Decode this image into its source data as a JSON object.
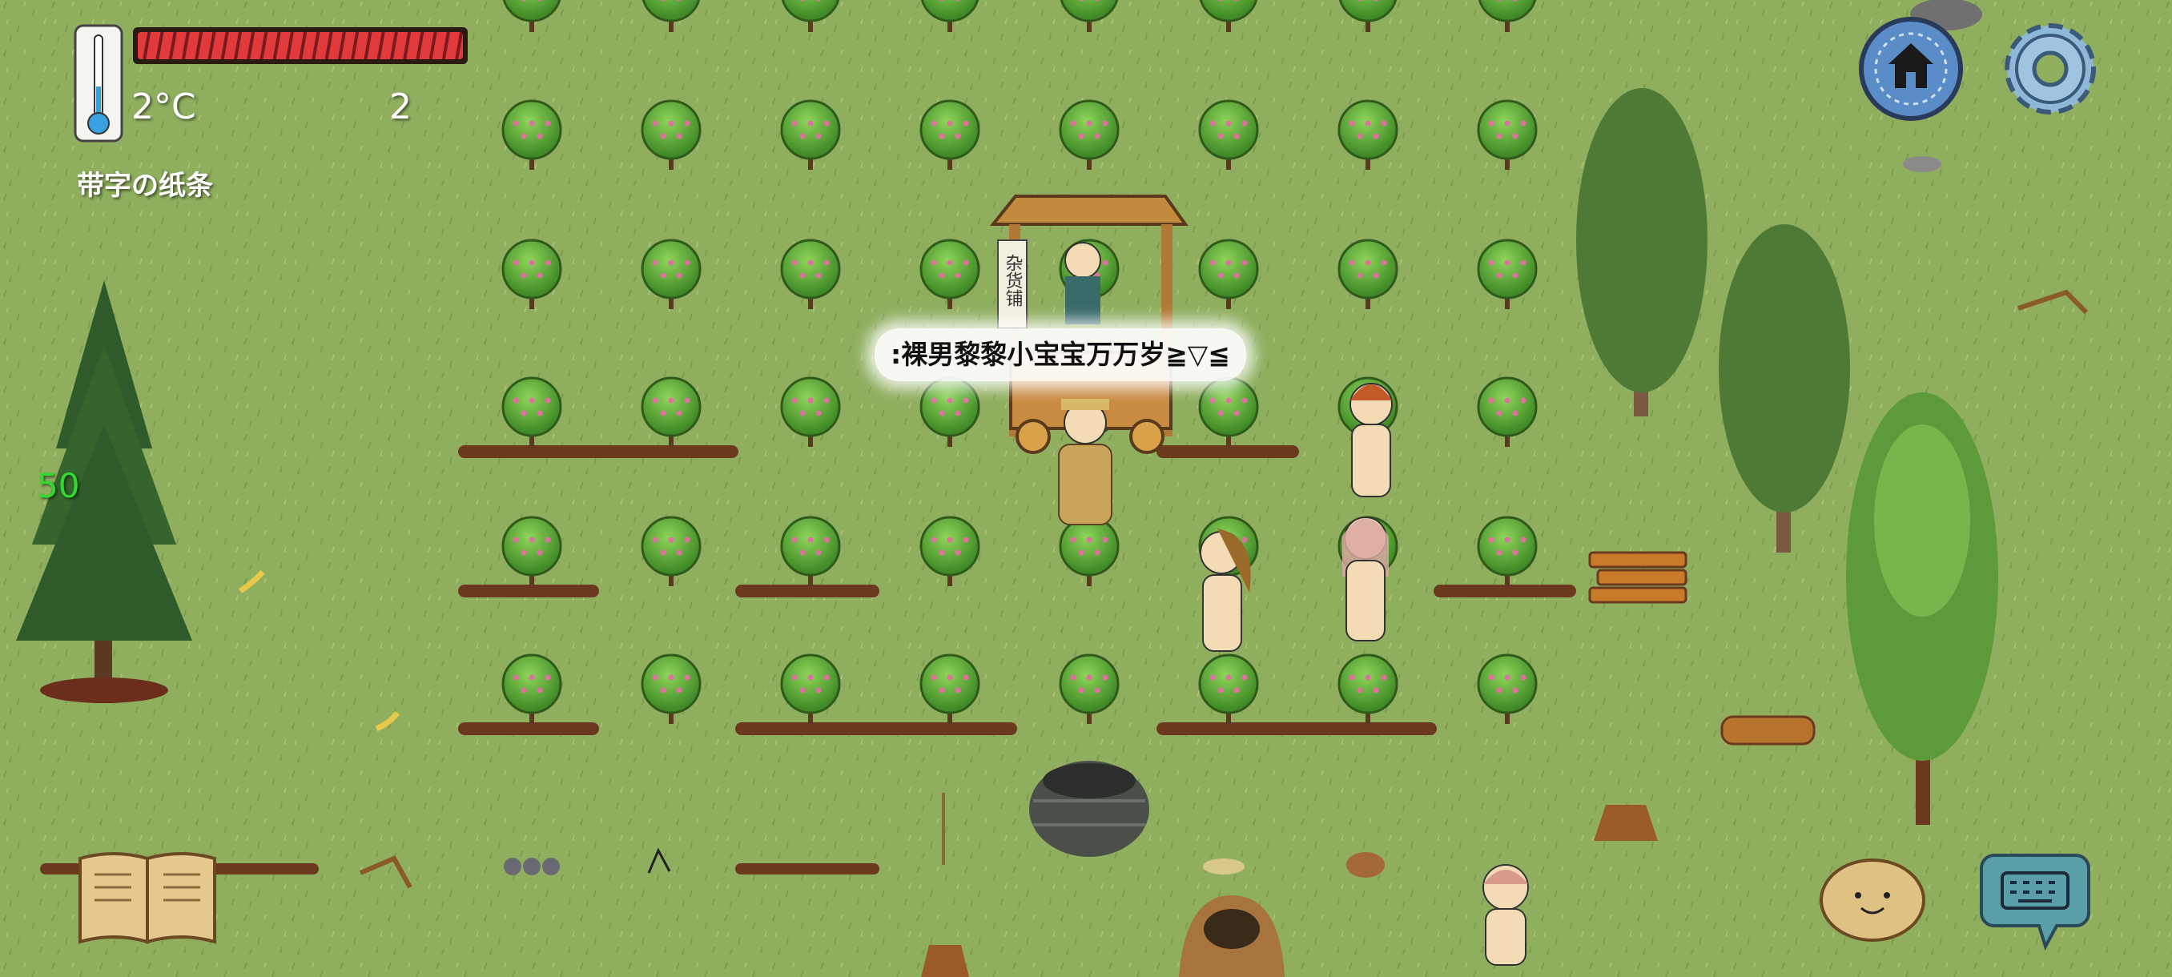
{
  "hud": {
    "temperature": "2°C",
    "count": "2",
    "held_item": "带字の纸条",
    "age": "50",
    "health_fraction": 1.0
  },
  "chat": {
    "message": ":裸男黎黎小宝宝万万岁≧▽≦"
  },
  "shop": {
    "sign": "杂货铺"
  },
  "icons": {
    "home": "home-icon",
    "settings": "gear-icon",
    "book": "book-icon",
    "emote": "emote-face-icon",
    "keyboard": "keyboard-icon",
    "thermometer": "thermometer-icon"
  },
  "colors": {
    "grass": "#8fae5e",
    "health": "#e23a3a",
    "age_text": "#32d932",
    "bush": "#5aa83a",
    "soil": "#6b3a1e"
  }
}
